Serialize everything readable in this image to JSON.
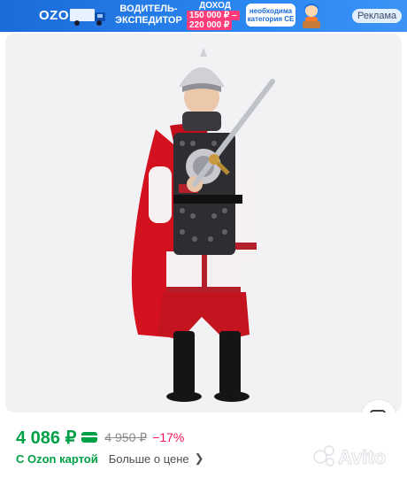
{
  "ad": {
    "logo": "OZON",
    "headline": "ВОДИТЕЛЬ-ЭКСПЕДИТОР",
    "income_label": "ДОХОД",
    "income_from": "150 000 ₽ –",
    "income_to": "220 000 ₽",
    "category_note": "необходима категория CE",
    "tag": "Реклама",
    "colors": {
      "background": "#2a86f0",
      "pill": "#ff3b7a"
    }
  },
  "product": {
    "image_icon": "zoom-image-icon",
    "price": "4 086 ₽",
    "old_price": "4 950 ₽",
    "discount": "−17%",
    "ozon_card_label": "С Ozon картой",
    "more_about_price": "Больше о цене",
    "chevron_icon": "chevron-right-icon",
    "colors": {
      "price": "#00a046",
      "discount": "#f91155",
      "old_price": "#8a8a8a"
    }
  },
  "watermark": {
    "logo": "Avito"
  }
}
